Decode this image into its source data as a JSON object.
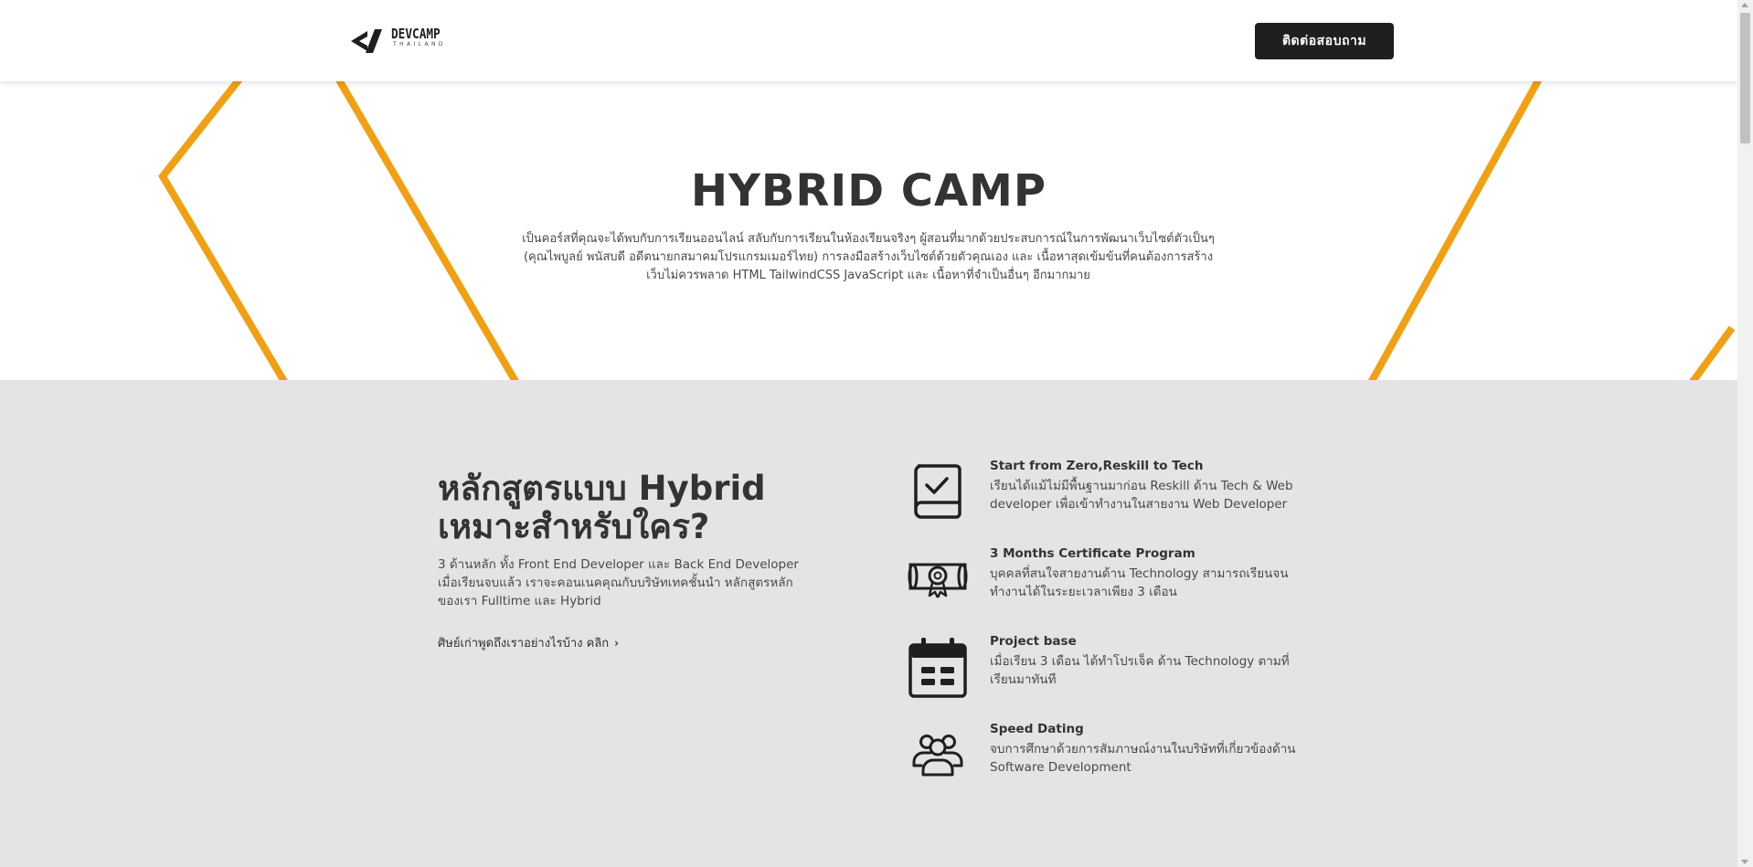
{
  "brand": {
    "logo_main": "DEVCAMP",
    "logo_sub": "THAILAND",
    "accent_color": "#f0a012",
    "dark_color": "#1f1f1f"
  },
  "header": {
    "cta_label": "ติดต่อสอบถาม"
  },
  "hero": {
    "title": "HYBRID CAMP",
    "description": "เป็นคอร์สที่คุณจะได้พบกับการเรียนออนไลน์ สลับกับการเรียนในห้องเรียนจริงๆ ผู้สอนที่มากด้วยประสบการณ์ในการพัฒนาเว็บไซต์ตัวเป็นๆ (คุณไพบูลย์ พนัสบดี อดีตนายกสมาคมโปรแกรมเมอร์ไทย) การลงมือสร้างเว็บไซต์ด้วยตัวคุณเอง และ เนื้อหาสุดเข้มข้นที่คนต้องการสร้างเว็บไม่ควรพลาด HTML TailwindCSS JavaScript และ เนื้อหาที่จำเป็นอื่นๆ อีกมากมาย"
  },
  "section": {
    "title": "หลักสูตรแบบ Hybrid เหมาะสำหรับใคร?",
    "description": "3 ด้านหลัก ทั้ง Front End Developer และ Back End Developer เมื่อเรียนจบแล้ว เราจะคอนเนคคุณกับบริษัทเทคชั้นนำ หลักสูตรหลักของเรา Fulltime และ Hybrid",
    "link_label": "ศิษย์เก่าพูดถึงเราอย่างไรบ้าง คลิก",
    "features": [
      {
        "icon": "book-check-icon",
        "title": "Start from Zero,Reskill to Tech",
        "desc": "เรียนได้แม้ไม่มีพื้นฐานมาก่อน Reskill ด้าน Tech & Web developer เพื่อเข้าทำงานในสายงาน Web Developer"
      },
      {
        "icon": "certificate-icon",
        "title": "3 Months Certificate Program",
        "desc": "บุคคลที่สนใจสายงานด้าน Technology สามารถเรียนจนทำงานได้ในระยะเวลาเพียง 3 เดือน"
      },
      {
        "icon": "calendar-icon",
        "title": "Project base",
        "desc": "เมื่อเรียน 3 เดือน ได้ทำโปรเจ็ค ด้าน Technology ตามที่เรียนมาทันที"
      },
      {
        "icon": "people-group-icon",
        "title": "Speed Dating",
        "desc": "จบการศึกษาด้วยการสัมภาษณ์งานในบริษัทที่เกี่ยวข้องด้าน Software Development"
      }
    ]
  }
}
